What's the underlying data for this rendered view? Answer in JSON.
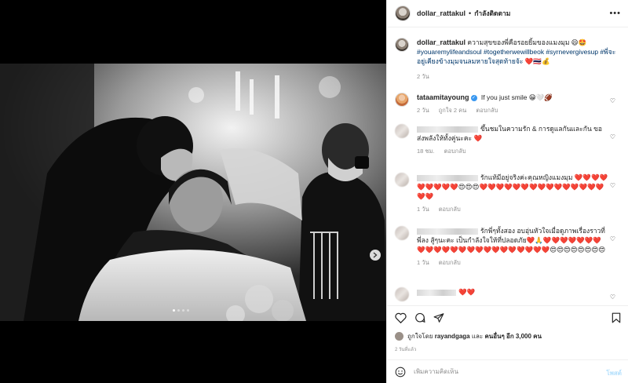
{
  "post": {
    "author": "dollar_rattakul",
    "separator": "•",
    "follow_status": "กำลังติดตาม",
    "more": "•••"
  },
  "caption": {
    "username": "dollar_rattakul",
    "text": "ความสุขของพี่คือรอยยิ้มของแมงมุม 😄🤩",
    "hashtags": "#youaremylifeandsoul #togetherwewillbeok #syrnevergivesup #พี่จะอยู่เคียงข้างมุมจนลมหายใจสุดท้ายจ้ะ",
    "emoji_tail": "❤️🇹🇭💰",
    "age": "2 วัน"
  },
  "comments": [
    {
      "username": "tataamitayoung",
      "verified": true,
      "text": "If you just smile 😁🤍🏈",
      "age": "2 วัน",
      "likes": "ถูกใจ 2 คน",
      "reply": "ตอบกลับ"
    },
    {
      "text": "ขึ้นชมในความรัก & การดูแลกันและกัน ขอส่งพลังให้ทั้งคู่นะคะ ❤️",
      "age": "18 ชม.",
      "reply": "ตอบกลับ"
    },
    {
      "text": "รักแท้มีอยู่จริงค่ะคุณหญิงแมงมุม ❤️❤️❤️❤️❤️❤️❤️❤️❤️😍😍😍❤️❤️❤️❤️❤️❤️❤️❤️❤️❤️❤️❤️❤️❤️❤️❤️❤️",
      "age": "1 วัน",
      "reply": "ตอบกลับ"
    },
    {
      "text": "รักพี่ๆทั้งสอง อบอุ่นหัวใจเมื่อดูภาพเรื่องราวที่พี่ลง สู้ๆนะคะ เป็นกำลังใจให้ที่ปลอดภัย❤️🙏❤️❤️❤️❤️❤️❤️❤️❤️❤️❤️❤️❤️❤️❤️❤️❤️❤️❤️❤️❤️❤️❤️❤️😍😍😍😍😍😍😍😍",
      "age": "1 วัน",
      "reply": "ตอบกลับ"
    },
    {
      "text": "❤️❤️"
    }
  ],
  "likes": {
    "prefix": "ถูกใจโดย",
    "user": "rayandgaga",
    "and": "และ",
    "others": "คนอื่นๆ อีก 3,000 คน"
  },
  "post_age": "2 วันที่แล้ว",
  "add_comment": {
    "placeholder": "เพิ่มความคิดเห็น",
    "post_label": "โพสต์"
  },
  "icons": {
    "like": "heart-icon",
    "comment": "comment-icon",
    "share": "send-icon",
    "save": "bookmark-icon",
    "emoji": "emoji-icon",
    "next": "chevron-right-icon"
  },
  "colors": {
    "link": "#00376b",
    "verified": "#3897f0",
    "heart": "#ed4956",
    "muted": "#8e8e8e"
  }
}
